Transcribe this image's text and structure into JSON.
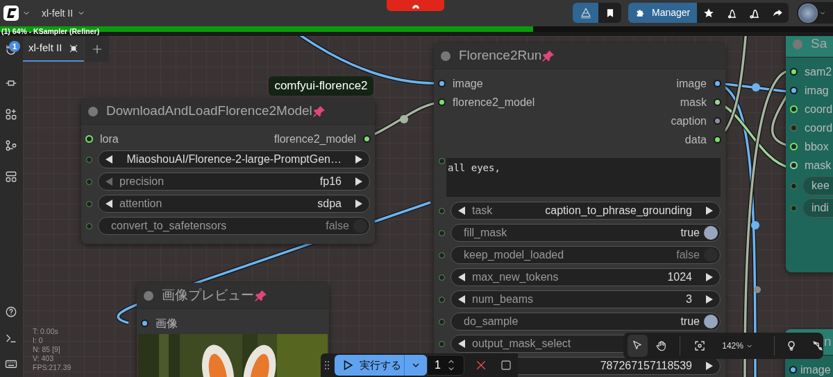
{
  "workflow_title": "xl-felt II",
  "progress": {
    "text": "(1) 64% - KSampler (Refiner)",
    "level": 0.64
  },
  "manager_label": "Manager",
  "queue_badge": "1",
  "tabs": [
    {
      "label": "xl-felt II",
      "selected": true
    }
  ],
  "group_label": "comfyui-florence2",
  "nodes": [
    {
      "title": "DownloadAndLoadFlorence2Model",
      "color": "#353535",
      "pinned": true,
      "inputs": [
        {
          "name": "lora",
          "color": "#7be06b",
          "filled": false
        }
      ],
      "outputs": [
        {
          "name": "florence2_model",
          "color": "#7be06b",
          "filled": true
        }
      ],
      "widgets": [
        {
          "kind": "combo",
          "value": "MiaoshouAI/Florence-2-large-PromptGen…",
          "prev_disabled": false
        },
        {
          "kind": "combo",
          "label": "precision",
          "value": "fp16",
          "prev_disabled": true
        },
        {
          "kind": "combo",
          "label": "attention",
          "value": "sdpa",
          "prev_disabled": false
        },
        {
          "kind": "toggle",
          "label": "convert_to_safetensors",
          "value": "false",
          "on": false
        }
      ]
    },
    {
      "title": "Florence2Run",
      "color": "#353535",
      "pinned": true,
      "inputs": [
        {
          "name": "image",
          "color": "#6cb4f0",
          "filled": true
        },
        {
          "name": "florence2_model",
          "color": "#7be06b",
          "filled": true
        }
      ],
      "outputs": [
        {
          "name": "image",
          "color": "#6cb4f0",
          "filled": true
        },
        {
          "name": "mask",
          "color": "#9fd39a",
          "filled": true
        },
        {
          "name": "caption",
          "color": "#8f8ca3",
          "filled": true
        },
        {
          "name": "data",
          "color": "#7be06b",
          "filled": true
        }
      ],
      "widgets": [
        {
          "kind": "text",
          "value": "all eyes,"
        },
        {
          "kind": "combo",
          "label": "task",
          "value": "caption_to_phrase_grounding",
          "prev_disabled": false
        },
        {
          "kind": "toggle",
          "label": "fill_mask",
          "value": "true",
          "on": true
        },
        {
          "kind": "toggle",
          "label": "keep_model_loaded",
          "value": "false",
          "on": false
        },
        {
          "kind": "combo",
          "label": "max_new_tokens",
          "value": "1024",
          "prev_disabled": false
        },
        {
          "kind": "combo",
          "label": "num_beams",
          "value": "3",
          "prev_disabled": false
        },
        {
          "kind": "toggle",
          "label": "do_sample",
          "value": "true",
          "on": true
        },
        {
          "kind": "combo",
          "label": "output_mask_select",
          "prev_disabled": false
        },
        {
          "kind": "combo",
          "value": "787267157118539"
        }
      ]
    },
    {
      "title": "画像プレビュー",
      "color": "#353535",
      "pinned": true,
      "inputs": [
        {
          "name": "画像",
          "color": "#6cb4f0",
          "filled": true
        }
      ],
      "image": {
        "kind": "picture"
      }
    },
    {
      "title": "Sa",
      "color": "#1d6659",
      "pinned": false,
      "inputs": [
        {
          "name": "sam2",
          "color": "#7be06b",
          "filled": true
        },
        {
          "name": "imag",
          "color": "#6cb4f0",
          "filled": true
        },
        {
          "name": "coord",
          "color": "#7be06b",
          "filled": false
        },
        {
          "name": "coord",
          "color": "#506a50",
          "filled": false
        },
        {
          "name": "bbox",
          "color": "#7be06b",
          "filled": false
        },
        {
          "name": "mask",
          "color": "#9fd39a",
          "filled": false
        }
      ],
      "widgets": [
        {
          "kind": "pill",
          "label": "kee"
        },
        {
          "kind": "pill",
          "label": "indi"
        }
      ]
    },
    {
      "title": "n",
      "color": "#1d6659",
      "pinned": false,
      "inputs": [
        {
          "name": "image",
          "color": "#6cb4f0",
          "filled": true
        }
      ]
    }
  ],
  "stats": [
    "T: 0.00s",
    "I: 0",
    "N: 85 [9]",
    "V: 403",
    "FPS:217.39"
  ],
  "run_bar": {
    "run_label": "実行する",
    "batch_count": "1"
  },
  "canvas_tools": [
    {
      "kind": "select",
      "selected": true
    },
    {
      "kind": "hand",
      "selected": false
    }
  ],
  "zoom": "142%"
}
